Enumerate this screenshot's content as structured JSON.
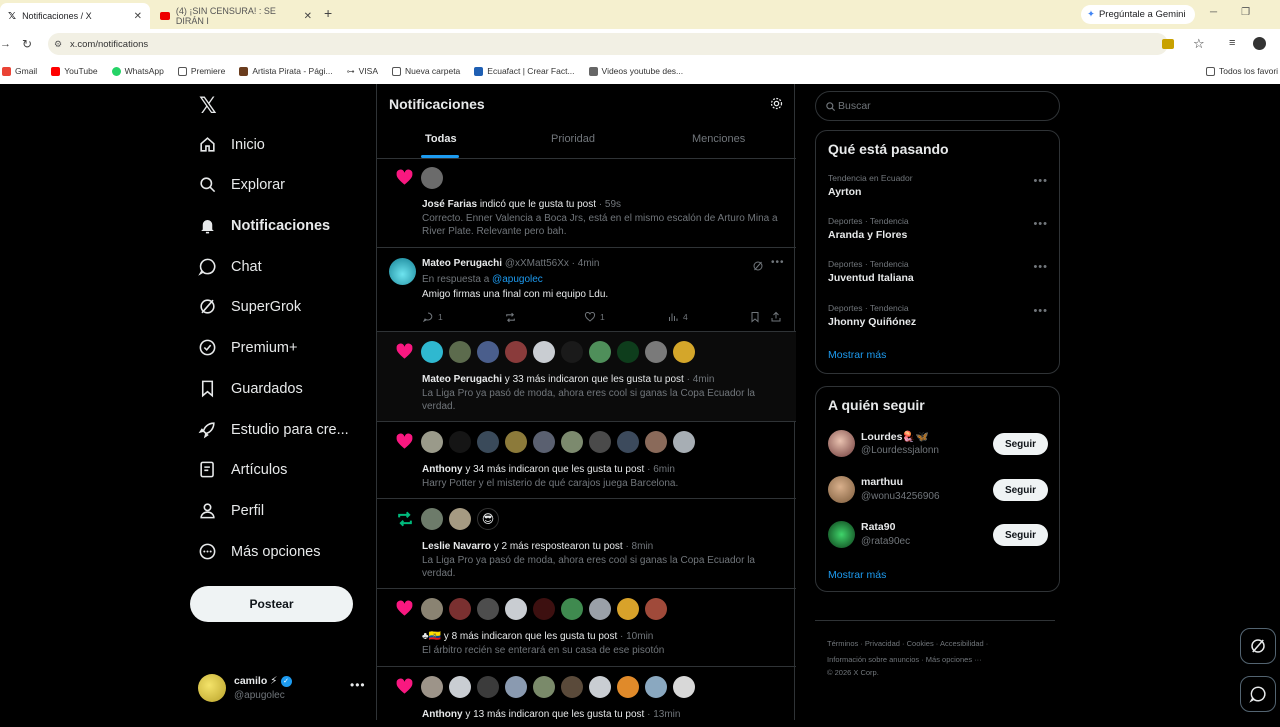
{
  "browser": {
    "tabs": [
      {
        "title": "Notificaciones / X"
      },
      {
        "title": "(4) ¡SIN CENSURA! : SE DIRÁN I"
      }
    ],
    "gemini_label": "Pregúntale a Gemini",
    "url": "x.com/notifications",
    "bookmarks": [
      "Gmail",
      "YouTube",
      "WhatsApp",
      "Premiere",
      "Artista Pirata - Pági...",
      "VISA",
      "Nueva carpeta",
      "Ecuafact | Crear Fact...",
      "Videos youtube des..."
    ],
    "bookmarks_right": "Todos los favori"
  },
  "nav": {
    "items": [
      "Inicio",
      "Explorar",
      "Notificaciones",
      "Chat",
      "SuperGrok",
      "Premium+",
      "Guardados",
      "Estudio para cre...",
      "Artículos",
      "Perfil",
      "Más opciones"
    ],
    "post_button": "Postear",
    "account": {
      "name": "camilo ⚡",
      "handle": "@apugolec"
    }
  },
  "main": {
    "title": "Notificaciones",
    "tabs": [
      "Todas",
      "Prioridad",
      "Menciones"
    ],
    "notifications": [
      {
        "who": "José Farias",
        "action": " indicó que le gusta tu post",
        "time": " · 59s",
        "text": "Correcto. Enner Valencia a Boca Jrs, está en el mismo escalón de Arturo Mina a River Plate. Relevante pero bah."
      },
      {
        "name": "Mateo Perugachi",
        "handle": "@xXMatt56Xx",
        "time": " · 4min",
        "reply_prefix": "En respuesta a ",
        "reply_to": "@apugolec",
        "text": "Amigo firmas una final con mi equipo Ldu.",
        "replies": "1",
        "likes": "1",
        "views": "4"
      },
      {
        "who": "Mateo Perugachi",
        "action": " y 33 más indicaron que les gusta tu post",
        "time": " · 4min",
        "text": "La Liga Pro ya pasó de moda, ahora eres cool si ganas la Copa Ecuador la verdad."
      },
      {
        "who": "Anthony",
        "action": " y 34 más indicaron que les gusta tu post",
        "time": " · 6min",
        "text": "Harry Potter y el misterio de qué carajos juega Barcelona."
      },
      {
        "who": "Leslie Navarro",
        "action": " y 2 más respostearon tu post",
        "time": " · 8min",
        "text": "La Liga Pro ya pasó de moda, ahora eres cool si ganas la Copa Ecuador la verdad."
      },
      {
        "who": "♣🇪🇨",
        "action": " y 8 más indicaron que les gusta tu post",
        "time": " · 10min",
        "text": "El árbitro recién se enterará en su casa de ese pisotón"
      },
      {
        "who": "Anthony",
        "action": " y 13 más indicaron que les gusta tu post",
        "time": " · 13min"
      }
    ]
  },
  "right": {
    "search_placeholder": "Buscar",
    "trends_title": "Qué está pasando",
    "trends": [
      {
        "meta": "Tendencia en Ecuador",
        "name": "Ayrton"
      },
      {
        "meta": "Deportes · Tendencia",
        "name": "Aranda y Flores"
      },
      {
        "meta": "Deportes · Tendencia",
        "name": "Juventud Italiana"
      },
      {
        "meta": "Deportes · Tendencia",
        "name": "Jhonny Quiñónez"
      }
    ],
    "show_more": "Mostrar más",
    "follow_title": "A quién seguir",
    "follow": [
      {
        "name": "Lourdes🪼🦋",
        "handle": "@Lourdessjalonn",
        "button": "Seguir"
      },
      {
        "name": "marthuu",
        "handle": "@wonu34256906",
        "button": "Seguir"
      },
      {
        "name": "Rata90",
        "handle": "@rata90ec",
        "button": "Seguir"
      }
    ],
    "footer_line1": "Términos · Privacidad · Cookies · Accesibilidad ·",
    "footer_line2": "Información sobre anuncios · Más opciones ···",
    "footer_line3": "© 2026 X Corp."
  },
  "colors": {
    "accent": "#1d9bf0",
    "like": "#f91880",
    "repost": "#00ba7c",
    "border": "#2f3336"
  }
}
